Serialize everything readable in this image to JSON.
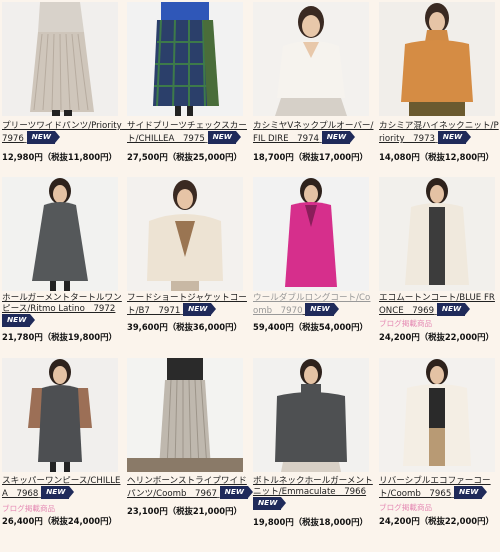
{
  "products": [
    {
      "name": "プリーツワイドパンツ/Priority　7976",
      "new_label": "NEW",
      "price": "12,980円（税抜11,800円）",
      "blog": "",
      "gray": false
    },
    {
      "name": "サイドプリーツチェックスカート/CHILLEA　7975",
      "new_label": "NEW",
      "price": "27,500円（税抜25,000円）",
      "blog": "",
      "gray": false
    },
    {
      "name": "カシミヤVネックプルオーバー/FIL DIRE　7974",
      "new_label": "NEW",
      "price": "18,700円（税抜17,000円）",
      "blog": "",
      "gray": false
    },
    {
      "name": "カシミア混ハイネックニット/Priority　7973",
      "new_label": "NEW",
      "price": "14,080円（税抜12,800円）",
      "blog": "",
      "gray": false
    },
    {
      "name": "ホールガーメントタートルワンピース/Ritmo Latino　7972",
      "new_label": "NEW",
      "price": "21,780円（税抜19,800円）",
      "blog": "",
      "gray": false
    },
    {
      "name": "フードショートジャケットコート/B7　7971",
      "new_label": "NEW",
      "price": "39,600円（税抜36,000円）",
      "blog": "",
      "gray": false
    },
    {
      "name": "ウールダブルロングコート/Coomb　7970",
      "new_label": "NEW",
      "price": "59,400円（税抜54,000円）",
      "blog": "",
      "gray": true
    },
    {
      "name": "エコムートンコート/BLUE FRONCE　7969",
      "new_label": "NEW",
      "price": "24,200円（税抜22,000円）",
      "blog": "ブログ掲載商品",
      "gray": false
    },
    {
      "name": "スキッパーワンピース/CHILLEA　7968",
      "new_label": "NEW",
      "price": "26,400円（税抜24,000円）",
      "blog": "ブログ掲載商品",
      "gray": false
    },
    {
      "name": "ヘリンボーンストライプワイドパンツ/Coomb　7967",
      "new_label": "NEW",
      "price": "23,100円（税抜21,000円）",
      "blog": "",
      "gray": false
    },
    {
      "name": "ボトルネックホールガーメントニット/Emmaculate　7966",
      "new_label": "NEW",
      "price": "19,800円（税抜18,000円）",
      "blog": "",
      "gray": false
    },
    {
      "name": "リバーシブルエコファーコート/Coomb　7965",
      "new_label": "NEW",
      "price": "24,200円（税抜22,000円）",
      "blog": "ブログ掲載商品",
      "gray": false
    }
  ],
  "colors": {
    "badge": "#1f2a5a",
    "blog": "#e58ab4",
    "background": "#fbf4ec"
  }
}
